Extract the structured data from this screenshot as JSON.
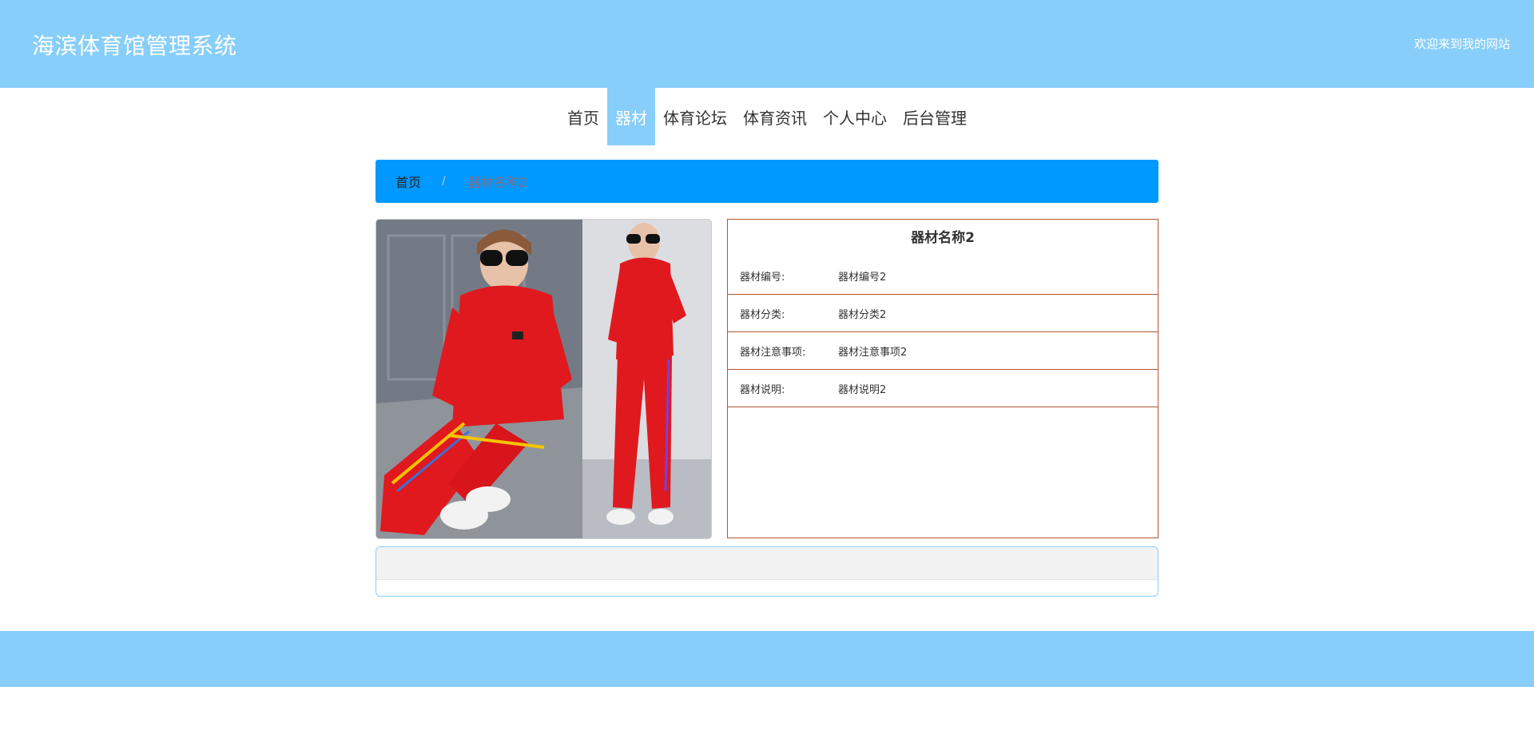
{
  "header": {
    "title": "海滨体育馆管理系统",
    "welcome": "欢迎来到我的网站"
  },
  "nav": {
    "items": [
      {
        "label": "首页"
      },
      {
        "label": "器材"
      },
      {
        "label": "体育论坛"
      },
      {
        "label": "体育资讯"
      },
      {
        "label": "个人中心"
      },
      {
        "label": "后台管理"
      }
    ],
    "active_index": 1
  },
  "breadcrumb": {
    "home": "首页",
    "separator": "/",
    "current": "器材名称2"
  },
  "detail": {
    "name": "器材名称2",
    "fields": [
      {
        "label": "器材编号:",
        "value": "器材编号2"
      },
      {
        "label": "器材分类:",
        "value": "器材分类2"
      },
      {
        "label": "器材注意事项:",
        "value": "器材注意事项2"
      },
      {
        "label": "器材说明:",
        "value": "器材说明2"
      }
    ]
  },
  "colors": {
    "header_bg": "#87cefa",
    "breadcrumb_bg": "#0099ff",
    "info_border": "#b5542e"
  }
}
